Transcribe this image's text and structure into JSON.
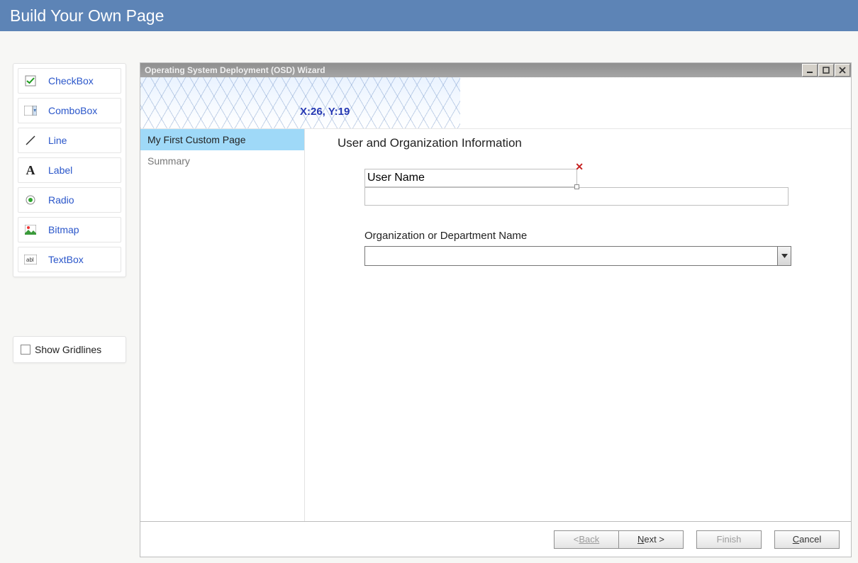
{
  "header": {
    "title": "Build Your Own Page"
  },
  "toolbox": {
    "items": [
      {
        "label": "CheckBox"
      },
      {
        "label": "ComboBox"
      },
      {
        "label": "Line"
      },
      {
        "label": "Label"
      },
      {
        "label": "Radio"
      },
      {
        "label": "Bitmap"
      },
      {
        "label": "TextBox"
      }
    ]
  },
  "gridlines": {
    "label": "Show Gridlines",
    "checked": false
  },
  "wizard": {
    "title": "Operating System Deployment (OSD) Wizard",
    "coord": "X:26, Y:19",
    "nav": [
      {
        "label": "My First Custom Page",
        "active": true
      },
      {
        "label": "Summary",
        "active": false
      }
    ],
    "heading": "User and Organization Information",
    "fields": {
      "username_label": "User Name",
      "username_value": "",
      "org_label": "Organization or Department Name",
      "org_value": ""
    },
    "buttons": {
      "back": "Back",
      "next": "Next >",
      "finish": "Finish",
      "cancel": "Cancel"
    }
  }
}
